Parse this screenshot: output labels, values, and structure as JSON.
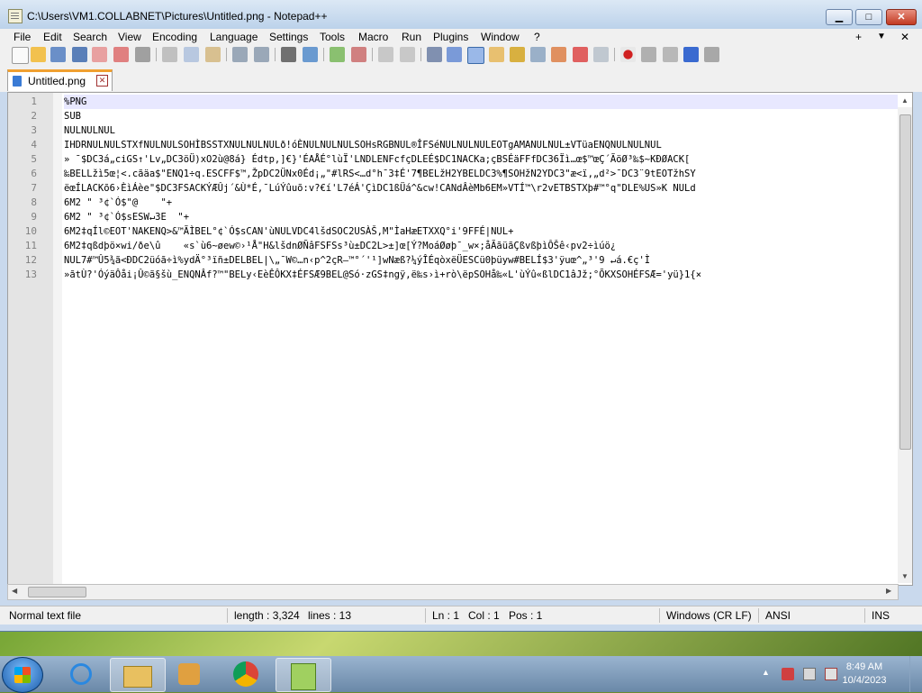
{
  "window": {
    "title": "C:\\Users\\VM1.COLLABNET\\Pictures\\Untitled.png - Notepad++"
  },
  "title_buttons": {
    "minimize": "▁",
    "maximize": "□",
    "close": "✕"
  },
  "menu": [
    "File",
    "Edit",
    "Search",
    "View",
    "Encoding",
    "Language",
    "Settings",
    "Tools",
    "Macro",
    "Run",
    "Plugins",
    "Window",
    "?"
  ],
  "menu_right": {
    "plus": "+",
    "dropdown": "▼",
    "close": "✕"
  },
  "toolbar": {
    "icons": [
      "new-file-icon",
      "open-file-icon",
      "save-icon",
      "save-all-icon",
      "close-icon",
      "close-all-icon",
      "print-icon",
      "cut-icon",
      "copy-icon",
      "paste-icon",
      "undo-icon",
      "redo-icon",
      "find-icon",
      "replace-icon",
      "zoom-in-icon",
      "zoom-out-icon",
      "sync-vertical-icon",
      "sync-horizontal-icon",
      "word-wrap-icon",
      "show-all-chars-icon",
      "indent-guide-icon",
      "udl-icon",
      "doc-map-icon",
      "function-list-icon",
      "folder-workspace-icon",
      "monitor-icon",
      "record-macro-icon",
      "stop-record-icon",
      "play-macro-icon",
      "run-macro-multiple-icon",
      "save-macro-icon"
    ]
  },
  "tab": {
    "label": "Untitled.png",
    "close": "✕"
  },
  "editor": {
    "line_numbers": [
      "1",
      "2",
      "3",
      "4",
      "5",
      "6",
      "7",
      "8",
      "9",
      "10",
      "11",
      "12",
      "13"
    ],
    "lines": [
      "%PNG",
      "SUB",
      "NULNULNUL",
      "IHDRNULNULSTXfNULNULSOHÌBSSTXNULNULNULð!óÈNULNULNULSOHsRGBNUL®ÎFSéNULNULNULEOTgAMANULNUL±VTüaENQNULNULNUL",
      "» ¯$DC3á„ciGS↑'Lv„DC3öÜ)xO2ù@8á} Édtp,]€}'ÉAÅÉ°lùÏ'LNDLENFcfçDLEÉ$DC1NACKa;çBSÉäFFfDC36Ïì…œ$™œÇ´ÃöØ³‰$~KÐØACK[",
      "‰BELLžì5œ¦<.cãäa$\"ENQ1÷q.ESCFF$™,ŽpDC2ÜNx0Éd¡„\"#lRS<…d°h¯3‡É'7¶BELžH2YBELDC3%¶SOHžN2YDC3\"æ<ï,„d²>¯DC3¨9tEOTžhSY",
      "ëœÍLACKõ6›ÈìÁèe\"$DC3FSACKÝÆÛj´&Ù*É,¯LúÝûuõ:v?€í'L7éÁ'ÇìDC1ßÜá^&cw!CANdÂèMb6EM»VTÍ™\\r2vETBSTXþ#™°q\"DLE%US»K NULd",
      "6M2 \" ³¢`Ó$\"@    \"+",
      "6M2 \" ³¢`Ó$sESW↵3E  \"+",
      "6M2‡qÍl©EOT'NAKENQ>&™ÃÌBEL°¢`Ó$sCAN'ùNULVDC4lšdSOC2USÀŠ,M\"ÌaHæETXXQ°i'9FFÉ|NUL+",
      "6M2‡qßdþö×wi/ðe\\û    «s`ù6~øew©›¹Å\"H&lšdnØÑâFSFSs³ù±DC2L>±]œ[Ý?MoáØøþ¯_w×;åÃãüãÇßvßþìÔŠê‹pv2÷ìúö¿",
      "NUL7#™Û5¾ã<ÐDC2üóã÷ì%ydÄ°³ïñ±DELBEL|\\„¯W©…n‹p^2çR—™°´'¹]wNæß?¼ýÎÉqòxëÜESCü0þüyw#BELÍ$3'ÿuœ^„³'9 ↵á.€ç'Ì",
      "»ãtÙ?'ÓýäÔåi¡Û©ã§šù_ENQNÂf?™\"BELy‹EèÊÔKX‡ÉFSÆ9BEL@Só·zGS‡ngÿ,ë‰s›ì+rò\\ëpSOHå‰«L'ùÝû«ßlDC1âJž;°ÕKXSOHÉFSÆ='yü}1{×"
    ]
  },
  "status": {
    "type": "Normal text file",
    "length": "length : 3,324",
    "lines": "lines : 13",
    "ln": "Ln : 1",
    "col": "Col : 1",
    "pos": "Pos : 1",
    "eol": "Windows (CR LF)",
    "encoding": "ANSI",
    "mode": "INS"
  },
  "taskbar": {
    "apps": [
      "internet-explorer-icon",
      "file-explorer-icon",
      "media-player-icon",
      "chrome-icon",
      "notepad-plus-plus-icon"
    ],
    "time": "8:49 AM",
    "date": "10/4/2023"
  },
  "colors": {
    "accent_tab": "#f0a030",
    "current_line": "#e8e8ff",
    "gutter": "#e4e4e4"
  }
}
